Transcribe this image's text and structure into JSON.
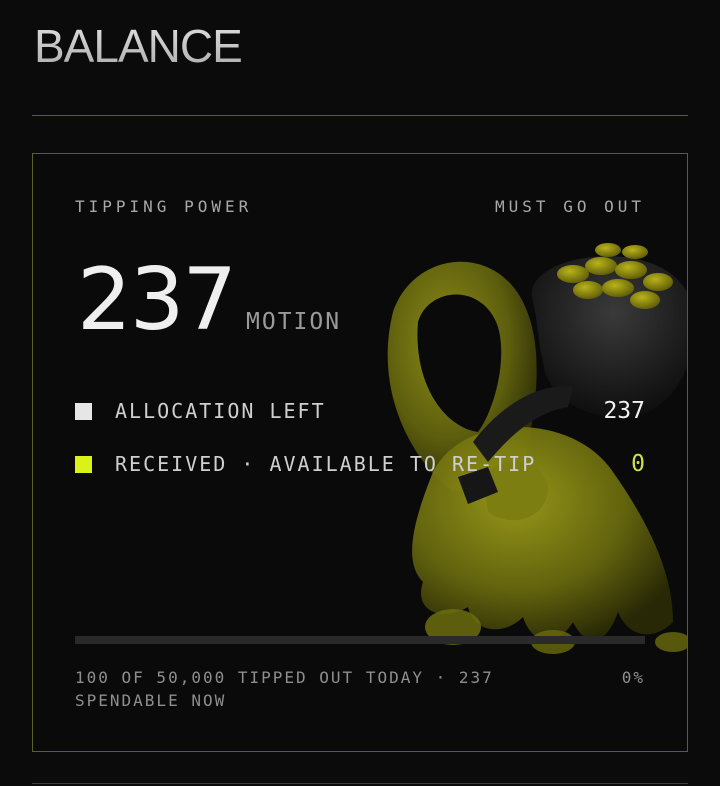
{
  "header": {
    "title": "BALANCE"
  },
  "card": {
    "label_left": "TIPPING POWER",
    "label_right": "MUST GO OUT",
    "amount": "237",
    "unit": "MOTION",
    "legend": [
      {
        "label": "ALLOCATION LEFT",
        "value": "237",
        "swatch_color": "#e6e6e6"
      },
      {
        "label": "RECEIVED · AVAILABLE TO RE-TIP",
        "value": "0",
        "swatch_color": "#d8f21a"
      }
    ],
    "progress_fraction": 0,
    "footer_text": "100 OF 50,000 TIPPED OUT TODAY · 237 SPENDABLE NOW",
    "footer_percent": "0%",
    "illustration_icon": "hooded-figure-with-coin-sack-illustration"
  },
  "colors": {
    "accent": "#d8f21a",
    "border": "#5a6123",
    "background": "#0b0b0b"
  }
}
